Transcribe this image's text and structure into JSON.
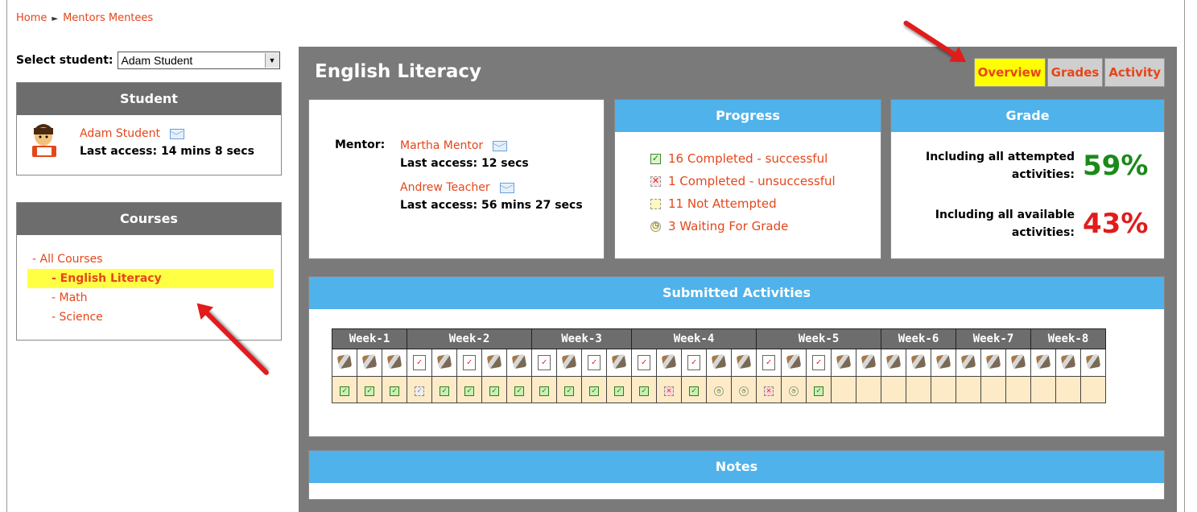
{
  "breadcrumb": {
    "home": "Home",
    "separator": "►",
    "current": "Mentors Mentees"
  },
  "select_student": {
    "label": "Select student:",
    "value": "Adam Student"
  },
  "student_block": {
    "heading": "Student",
    "name": "Adam Student",
    "last_access": "Last access: 14 mins 8 secs"
  },
  "courses_block": {
    "heading": "Courses",
    "all": "- All Courses",
    "items": [
      "- English Literacy",
      "- Math",
      "- Science"
    ]
  },
  "main": {
    "title": "English Literacy",
    "tabs": [
      "Overview",
      "Grades",
      "Activity"
    ],
    "mentor": {
      "label": "Mentor:",
      "people": [
        {
          "name": "Martha Mentor",
          "last_access": "Last access: 12 secs"
        },
        {
          "name": "Andrew Teacher",
          "last_access": "Last access: 56 mins 27 secs"
        }
      ]
    },
    "progress": {
      "heading": "Progress",
      "items": [
        {
          "icon": "check-icon",
          "text": "16 Completed - successful"
        },
        {
          "icon": "cross-icon",
          "text": "1 Completed - unsuccessful"
        },
        {
          "icon": "empty-box-icon",
          "text": "11 Not Attempted"
        },
        {
          "icon": "clock-icon",
          "text": "3 Waiting For Grade"
        }
      ]
    },
    "grade": {
      "heading": "Grade",
      "attempted_label_1": "Including all attempted",
      "attempted_label_2": "activities:",
      "attempted_value": "59%",
      "available_label_1": "Including all available",
      "available_label_2": "activities:",
      "available_value": "43%",
      "colors": {
        "good": "#1a8a1a",
        "bad": "#e21b1b"
      }
    },
    "submitted": {
      "heading": "Submitted Activities",
      "weeks": [
        {
          "label": "Week-1",
          "span": 3
        },
        {
          "label": "Week-2",
          "span": 5
        },
        {
          "label": "Week-3",
          "span": 4
        },
        {
          "label": "Week-4",
          "span": 5
        },
        {
          "label": "Week-5",
          "span": 5
        },
        {
          "label": "Week-6",
          "span": 3
        },
        {
          "label": "Week-7",
          "span": 3
        },
        {
          "label": "Week-8",
          "span": 3
        }
      ],
      "types": [
        "tool",
        "tool",
        "tool",
        "doc",
        "tool",
        "doc",
        "tool",
        "tool",
        "doc",
        "tool",
        "doc",
        "tool",
        "doc",
        "tool",
        "doc",
        "tool",
        "tool",
        "doc",
        "tool",
        "doc",
        "tool",
        "tool",
        "tool",
        "tool",
        "tool",
        "tool",
        "tool",
        "tool",
        "tool",
        "tool",
        "tool"
      ],
      "statuses": [
        "ok",
        "ok",
        "ok",
        "okdim",
        "ok",
        "ok",
        "ok",
        "ok",
        "ok",
        "ok",
        "ok",
        "ok",
        "ok",
        "bad",
        "ok",
        "wait",
        "wait",
        "bad",
        "wait",
        "ok",
        "",
        "",
        "",
        "",
        "",
        "",
        "",
        "",
        "",
        "",
        ""
      ]
    },
    "notes": {
      "heading": "Notes"
    }
  }
}
